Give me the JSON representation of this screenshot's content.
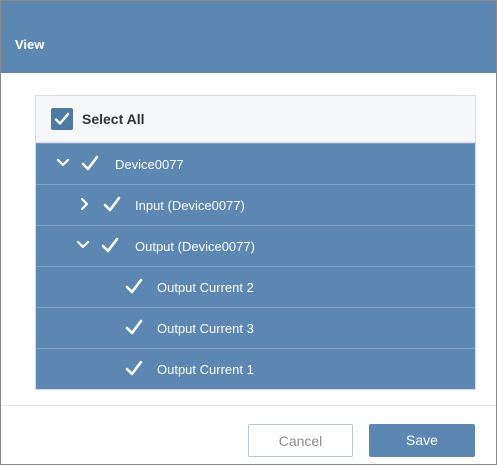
{
  "dialog": {
    "title": "View",
    "select_all_label": "Select All",
    "tree": [
      {
        "label": "Device0077",
        "indent": 0,
        "expander": "chevron-down"
      },
      {
        "label": "Input (Device0077)",
        "indent": 1,
        "expander": "chevron-right"
      },
      {
        "label": "Output (Device0077)",
        "indent": 1,
        "expander": "chevron-down"
      },
      {
        "label": "Output Current 2",
        "indent": 2,
        "expander": "none"
      },
      {
        "label": "Output Current 3",
        "indent": 2,
        "expander": "none"
      },
      {
        "label": "Output Current 1",
        "indent": 2,
        "expander": "none"
      }
    ],
    "cancel_label": "Cancel",
    "save_label": "Save"
  },
  "colors": {
    "header": "#5b87b2",
    "row": "#5b87b2",
    "checkbox": "#4f7aa6"
  },
  "icons": {
    "checkmark": "check-icon",
    "expand": "chevron-down-icon",
    "collapse": "chevron-right-icon"
  }
}
